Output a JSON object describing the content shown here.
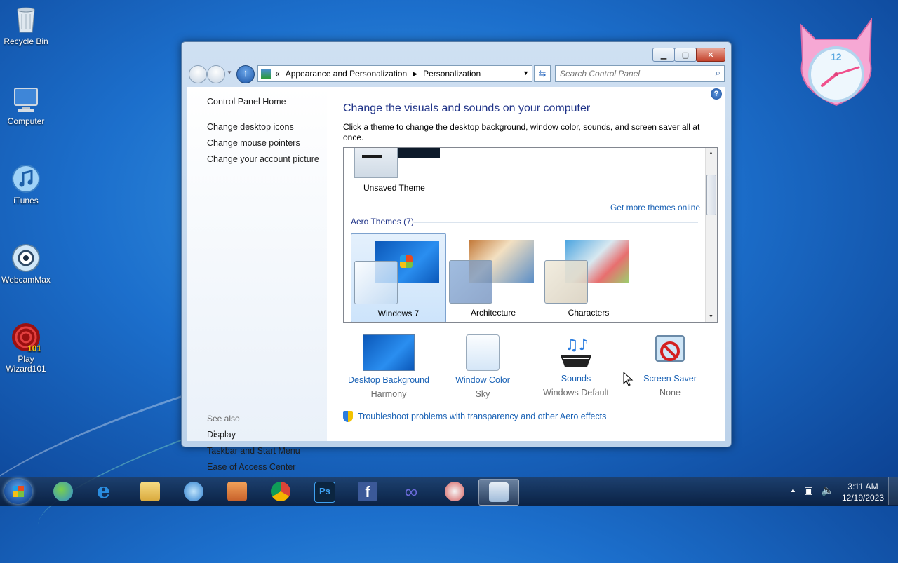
{
  "desktop": {
    "icons": [
      {
        "label": "Recycle Bin"
      },
      {
        "label": "Computer"
      },
      {
        "label": "iTunes"
      },
      {
        "label": "WebcamMax"
      },
      {
        "label": "Play Wizard101"
      }
    ],
    "gadget_clock": {
      "numeral": "12"
    }
  },
  "window": {
    "address": {
      "chevron": "«",
      "crumbs": [
        "Appearance and Personalization",
        "Personalization"
      ]
    },
    "search_placeholder": "Search Control Panel",
    "left_pane": {
      "home": "Control Panel Home",
      "links": [
        "Change desktop icons",
        "Change mouse pointers",
        "Change your account picture"
      ],
      "see_also_label": "See also",
      "see_also": [
        "Display",
        "Taskbar and Start Menu",
        "Ease of Access Center"
      ]
    },
    "main": {
      "title": "Change the visuals and sounds on your computer",
      "description": "Click a theme to change the desktop background, window color, sounds, and screen saver all at once.",
      "unsaved_theme": "Unsaved Theme",
      "get_more": "Get more themes online",
      "aero_heading": "Aero Themes (7)",
      "themes": [
        {
          "name": "Windows 7",
          "selected": true
        },
        {
          "name": "Architecture",
          "selected": false
        },
        {
          "name": "Characters",
          "selected": false
        }
      ],
      "settings": [
        {
          "title": "Desktop Background",
          "value": "Harmony"
        },
        {
          "title": "Window Color",
          "value": "Sky"
        },
        {
          "title": "Sounds",
          "value": "Windows Default"
        },
        {
          "title": "Screen Saver",
          "value": "None"
        }
      ],
      "troubleshoot": "Troubleshoot problems with transparency and other Aero effects"
    }
  },
  "taskbar": {
    "apps": [
      "windows-live-messenger",
      "internet-explorer",
      "windows-explorer",
      "itunes",
      "media-player",
      "chrome",
      "photoshop",
      "facebook",
      "infinity-app",
      "paint-app",
      "control-panel"
    ],
    "time": "3:11 AM",
    "date": "12/19/2023"
  },
  "colors": {
    "link": "#1a62b5",
    "title": "#1e3287",
    "accent": "#1c6fcc"
  }
}
